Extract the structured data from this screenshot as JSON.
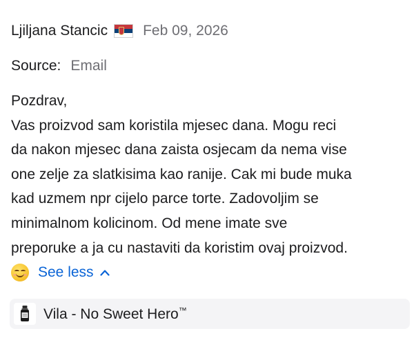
{
  "review": {
    "author": "Ljiljana Stancic",
    "flag_icon": "serbia-flag-icon",
    "date": "Feb 09, 2026",
    "source_label": "Source:",
    "source_value": "Email",
    "body_lines": [
      "Pozdrav,",
      "Vas proizvod sam koristila mjesec dana. Mogu reci",
      "da nakon mjesec dana zaista osjecam da nema vise",
      "one zelje za slatkisima kao ranije. Cak mi bude muka",
      "kad uzmem npr cijelo parce torte. Zadovoljim se",
      "minimalnom kolicinom. Od mene imate sve",
      "preporuke a ja cu nastaviti da koristim ovaj proizvod."
    ],
    "emoji_icon": "smiling-face-icon",
    "see_less_label": "See less"
  },
  "product": {
    "name": "Vila - No Sweet Hero",
    "trademark": "™",
    "thumb_icon": "product-bottle-icon"
  },
  "colors": {
    "link": "#0a64d6",
    "muted": "#6e6e73",
    "text": "#1c1c1e",
    "chip_bg": "#f4f4f6"
  }
}
